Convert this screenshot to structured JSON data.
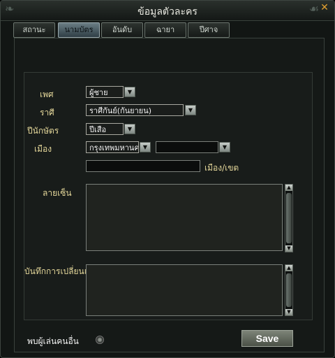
{
  "window": {
    "title": "ข้อมูลตัวละคร",
    "close_icon": "close-icon"
  },
  "tabs": [
    {
      "label": "สถานะ",
      "active": false
    },
    {
      "label": "นามบัตร",
      "active": true
    },
    {
      "label": "อันดับ",
      "active": false
    },
    {
      "label": "ฉายา",
      "active": false
    },
    {
      "label": "ปีศาจ",
      "active": false
    }
  ],
  "form": {
    "gender": {
      "label": "เพศ",
      "value": "ผู้ชาย"
    },
    "zodiac": {
      "label": "ราศี",
      "value": "ราศีกันย์(กันยายน)"
    },
    "year": {
      "label": "ปีนักษัตร",
      "value": "ปีเสือ"
    },
    "city": {
      "label": "เมือง",
      "value": "กรุงเทพมหานค",
      "district_value": ""
    },
    "district": {
      "label": "เมือง/เขต",
      "value": ""
    },
    "signature": {
      "label": "ลายเซ็น"
    },
    "changes": {
      "label": "บันทึกการเปลี่ยนแปลง"
    }
  },
  "footer": {
    "see_players_label": "พบผู้เล่นคนอื่น",
    "save_label": "Save"
  }
}
